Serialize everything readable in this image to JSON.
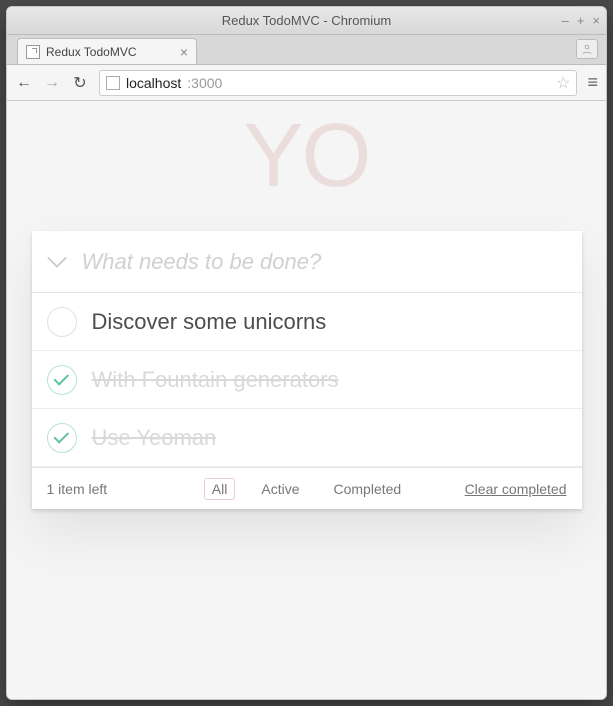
{
  "window": {
    "title": "Redux TodoMVC - Chromium"
  },
  "browser": {
    "tab_title": "Redux TodoMVC",
    "url_host": "localhost",
    "url_port": ":3000"
  },
  "app": {
    "title": "YO",
    "new_todo_placeholder": "What needs to be done?",
    "todos": [
      {
        "label": "Discover some unicorns",
        "completed": false
      },
      {
        "label": "With Fountain generators",
        "completed": true
      },
      {
        "label": "Use Yeoman",
        "completed": true
      }
    ],
    "footer": {
      "count_text": "1 item left",
      "filters": {
        "all": "All",
        "active": "Active",
        "completed": "Completed",
        "selected": "all"
      },
      "clear_label": "Clear completed"
    }
  }
}
